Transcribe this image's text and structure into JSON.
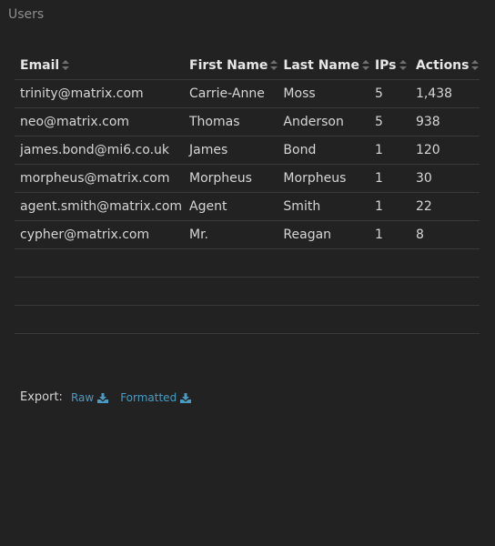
{
  "panel": {
    "title": "Users"
  },
  "table": {
    "columns": [
      {
        "label": "Email",
        "sort_icon": "sort-icon"
      },
      {
        "label": "First Name",
        "sort_icon": "sort-icon"
      },
      {
        "label": "Last Name",
        "sort_icon": "sort-icon"
      },
      {
        "label": "IPs",
        "sort_icon": "sort-icon"
      },
      {
        "label": "Actions",
        "sort_icon": "sort-icon"
      }
    ],
    "rows": [
      [
        "trinity@matrix.com",
        "Carrie-Anne",
        "Moss",
        "5",
        "1,438"
      ],
      [
        "neo@matrix.com",
        "Thomas",
        "Anderson",
        "5",
        "938"
      ],
      [
        "james.bond@mi6.co.uk",
        "James",
        "Bond",
        "1",
        "120"
      ],
      [
        "morpheus@matrix.com",
        "Morpheus",
        "Morpheus",
        "1",
        "30"
      ],
      [
        "agent.smith@matrix.com",
        "Agent",
        "Smith",
        "1",
        "22"
      ],
      [
        "cypher@matrix.com",
        "Mr.",
        "Reagan",
        "1",
        "8"
      ]
    ],
    "empty_rows": 3
  },
  "export": {
    "label": "Export:",
    "raw_label": "Raw",
    "formatted_label": "Formatted",
    "icon": "download-icon"
  },
  "colors": {
    "background": "#222222",
    "text": "#d6d6d6",
    "link": "#4a9bc4",
    "border": "#3a3a3a"
  }
}
